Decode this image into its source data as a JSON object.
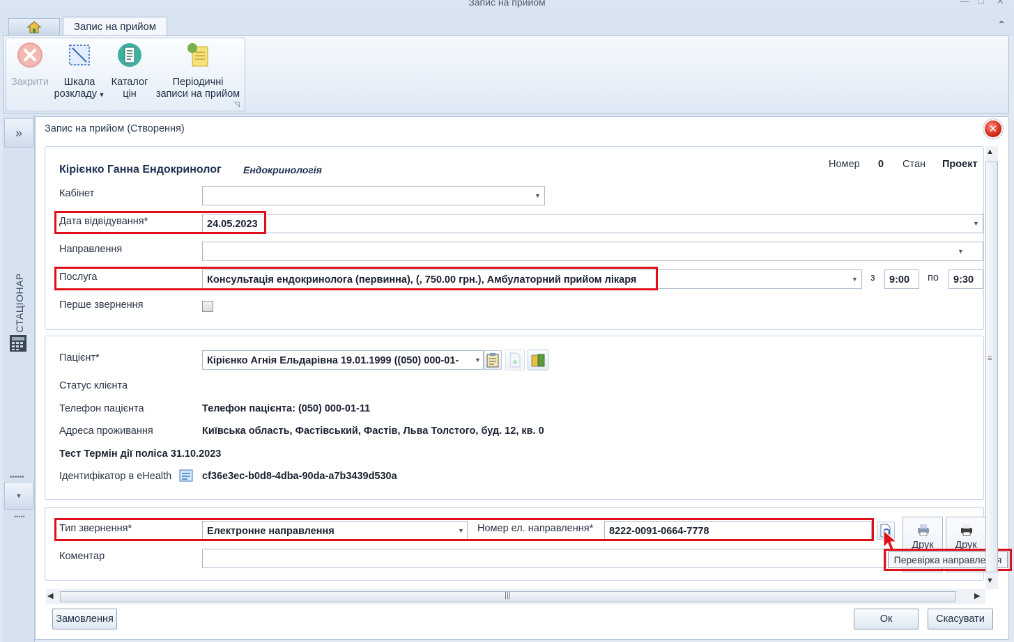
{
  "window": {
    "title": "Запис на прийом"
  },
  "ribbon": {
    "home_tab_icon": "home-icon",
    "active_tab": "Запис на прийом",
    "buttons": [
      {
        "label": "Закрити",
        "icon": "close-circle-icon",
        "enabled": false
      },
      {
        "label_line1": "Шкала",
        "label_line2": "розкладу",
        "icon": "schedule-scale-icon"
      },
      {
        "label_line1": "Каталог",
        "label_line2": "цін",
        "icon": "price-catalog-icon"
      },
      {
        "label_line1": "Періодичні",
        "label_line2": "записи на прийом",
        "icon": "periodic-records-icon"
      }
    ]
  },
  "side_panel": {
    "label": "СТАЦІОНАР"
  },
  "dialog": {
    "title": "Запис на прийом (Створення)",
    "doctor": {
      "name": "Кірієнко Ганна Ендокринолог",
      "specialty": "Ендокринологія"
    },
    "status": {
      "number_label": "Номер",
      "number_value": "0",
      "state_label": "Стан",
      "state_value": "Проект"
    },
    "cabinet": {
      "label": "Кабінет",
      "value": ""
    },
    "visit_date": {
      "label": "Дата відвідування*",
      "value": "24.05.2023"
    },
    "referral": {
      "label": "Направлення",
      "value": ""
    },
    "service": {
      "label": "Послуга",
      "value": "Консультація ендокринолога (первинна), (, 750.00 грн.), Амбулаторний прийом лікаря",
      "from_label": "з",
      "from_value": "9:00",
      "to_label": "по",
      "to_value": "9:30"
    },
    "first_visit": {
      "label": "Перше звернення",
      "checked": false
    },
    "patient": {
      "label": "Пацієнт*",
      "value": "Кірієнко Агнія Ельдарівна 19.01.1999 ((050) 000-01-",
      "client_status_label": "Статус клієнта",
      "phone_label": "Телефон пацієнта",
      "phone_value": "Телефон пацієнта: (050) 000-01-11",
      "address_label": "Адреса проживання",
      "address_value": "Київська область, Фастівський, Фастів, Льва Толстого, буд. 12, кв. 0",
      "policy_text": "Тест Термін дії поліса 31.10.2023",
      "ehealth_label": "Ідентифікатор в eHealth",
      "ehealth_value": "cf36e3ec-b0d8-4dba-90da-a7b3439d530a"
    },
    "appeal": {
      "type_label": "Тип звернення*",
      "type_value": "Електронне направлення",
      "referral_no_label": "Номер ел. направлення*",
      "referral_no_value": "8222-0091-0664-7778",
      "comment_label": "Коментар",
      "comment_value": "",
      "print1": "Друк",
      "print2": "Друк"
    },
    "tooltip": "Перевірка направлення",
    "buttons": {
      "order": "Замовлення",
      "ok": "Ок",
      "cancel": "Скасувати"
    }
  },
  "colors": {
    "highlight": "#e0101a",
    "accent": "#dfe8f3"
  }
}
